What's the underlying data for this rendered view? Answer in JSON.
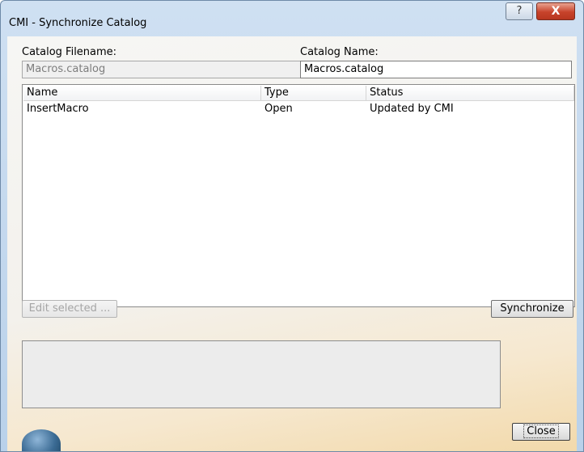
{
  "window": {
    "title": "CMI - Synchronize Catalog",
    "help_glyph": "?",
    "close_glyph": "X"
  },
  "catalog": {
    "filename_label": "Catalog Filename:",
    "filename_value": "Macros.catalog",
    "name_label": "Catalog Name:",
    "name_value": "Macros.catalog"
  },
  "table": {
    "columns": [
      "Name",
      "Type",
      "Status"
    ],
    "rows": [
      {
        "name": "InsertMacro",
        "type": "Open",
        "status": "Updated by CMI"
      }
    ]
  },
  "buttons": {
    "edit_selected": "Edit selected ...",
    "synchronize": "Synchronize",
    "close": "Close"
  },
  "message_area": "",
  "colors": {
    "titlebar": "#cfe0f2",
    "close_accent": "#c7432b"
  }
}
